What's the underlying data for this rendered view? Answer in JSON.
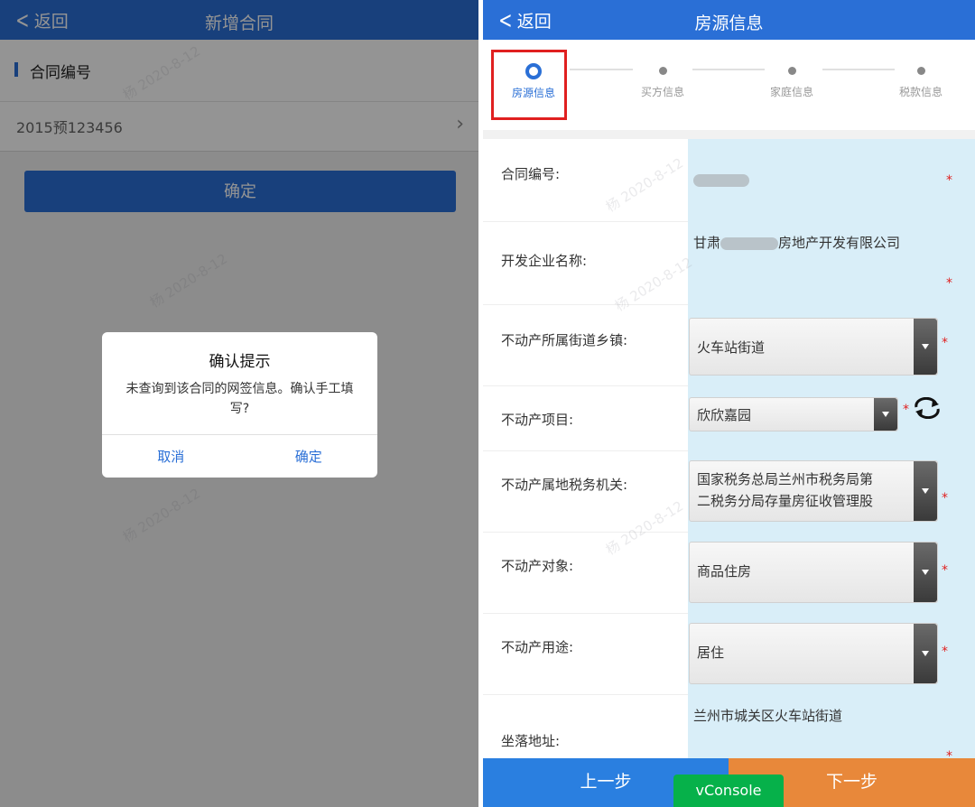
{
  "left_screen": {
    "nav": {
      "back_label": "返回",
      "title": "新增合同"
    },
    "section_label": "合同编号",
    "contract_value": "2015预123456",
    "confirm_button": "确定",
    "dialog": {
      "title": "确认提示",
      "message": "未查询到该合同的网签信息。确认手工填写?",
      "cancel": "取消",
      "ok": "确定"
    }
  },
  "right_screen": {
    "nav": {
      "back_label": "返回",
      "title": "房源信息"
    },
    "steps": [
      {
        "label": "房源信息",
        "active": true
      },
      {
        "label": "买方信息",
        "active": false
      },
      {
        "label": "家庭信息",
        "active": false
      },
      {
        "label": "税款信息",
        "active": false
      }
    ],
    "fields": {
      "contract_no": {
        "label": "合同编号:"
      },
      "developer": {
        "label": "开发企业名称:",
        "value_prefix": "甘肃",
        "value_suffix": "房地产开发有限公司"
      },
      "street": {
        "label": "不动产所属街道乡镇:",
        "value": "火车站街道"
      },
      "project": {
        "label": "不动产项目:",
        "value": "欣欣嘉园"
      },
      "tax_office": {
        "label": "不动产属地税务机关:",
        "value_line1": "国家税务总局兰州市税务局第",
        "value_line2": "二税务分局存量房征收管理股"
      },
      "object": {
        "label": "不动产对象:",
        "value": "商品住房"
      },
      "usage": {
        "label": "不动产用途:",
        "value": "居住"
      },
      "address": {
        "label": "坐落地址:",
        "value": "兰州市城关区火车站街道"
      }
    },
    "required_mark": "*",
    "prev_button": "上一步",
    "next_button": "下一步",
    "vconsole": "vConsole"
  },
  "colors": {
    "brand_blue": "#2a6fd6",
    "next_orange": "#e8883a",
    "vconsole_green": "#06b14a",
    "highlight_red": "#e02020"
  }
}
